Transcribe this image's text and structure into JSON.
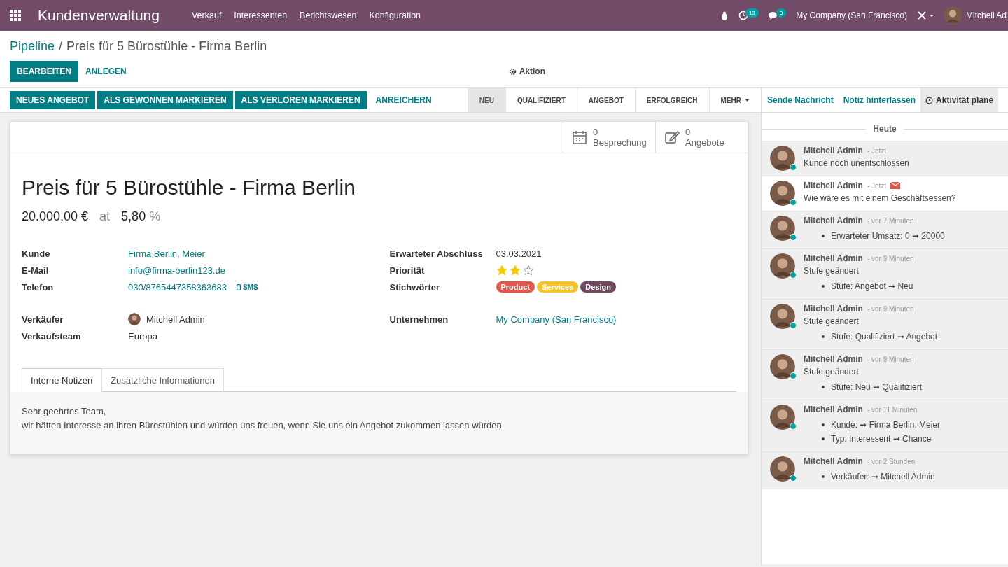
{
  "navbar": {
    "app_title": "Kundenverwaltung",
    "menu": [
      "Verkauf",
      "Interessenten",
      "Berichtswesen",
      "Konfiguration"
    ],
    "activity_count": "13",
    "message_count": "8",
    "company": "My Company (San Francisco)",
    "user": "Mitchell Ad"
  },
  "breadcrumb": {
    "parent": "Pipeline",
    "separator": "/",
    "current": "Preis für 5 Bürostühle - Firma Berlin"
  },
  "control_buttons": [
    {
      "label": "BEARBEITEN",
      "kind": "primary"
    },
    {
      "label": "ANLEGEN",
      "kind": "link"
    }
  ],
  "action_menu": "Aktion",
  "header_buttons": [
    {
      "label": "NEUES ANGEBOT",
      "kind": "primary"
    },
    {
      "label": "ALS GEWONNEN MARKIEREN",
      "kind": "primary"
    },
    {
      "label": "ALS VERLOREN MARKIEREN",
      "kind": "primary"
    },
    {
      "label": "ANREICHERN",
      "kind": "link"
    }
  ],
  "stages": [
    {
      "label": "NEU",
      "selected": true
    },
    {
      "label": "QUALIFIZIERT",
      "selected": false
    },
    {
      "label": "ANGEBOT",
      "selected": false
    },
    {
      "label": "ERFOLGREICH",
      "selected": false
    }
  ],
  "stages_more": "MEHR",
  "smart_buttons": [
    {
      "count": "0",
      "label": "Besprechung",
      "kind": "calendar"
    },
    {
      "count": "0",
      "label": "Angebote",
      "kind": "edit"
    }
  ],
  "record": {
    "title": "Preis für 5 Bürostühle - Firma Berlin",
    "revenue": "20.000,00 €",
    "at": "at",
    "probability": "5,80",
    "percent": "%"
  },
  "left_fields": [
    {
      "label": "Kunde",
      "value": "Firma Berlin, Meier",
      "kind": "link"
    },
    {
      "label": "E-Mail",
      "value": "info@firma-berlin123.de",
      "kind": "link"
    },
    {
      "label": "Telefon",
      "value": "030/8765447358363683",
      "kind": "phone",
      "extra": "SMS"
    },
    {
      "kind": "spacer"
    },
    {
      "label": "Verkäufer",
      "value": "Mitchell Admin",
      "kind": "user"
    },
    {
      "label": "Verkaufsteam",
      "value": "Europa",
      "kind": "text"
    }
  ],
  "right_fields": [
    {
      "label": "Erwarteter Abschluss",
      "value": "03.03.2021",
      "kind": "text"
    },
    {
      "label": "Priorität",
      "kind": "stars",
      "stars": 2
    },
    {
      "label": "Stichwörter",
      "kind": "tags",
      "tags": [
        {
          "name": "Product",
          "color": "#e2574c"
        },
        {
          "name": "Services",
          "color": "#f4c430"
        },
        {
          "name": "Design",
          "color": "#6d4a5f"
        }
      ]
    },
    {
      "kind": "spacer"
    },
    {
      "label": "Unternehmen",
      "value": "My Company (San Francisco)",
      "kind": "link"
    }
  ],
  "notebook": {
    "tabs": [
      {
        "label": "Interne Notizen",
        "selected": true
      },
      {
        "label": "Zusätzliche Informationen",
        "selected": false
      }
    ],
    "lines": [
      "Sehr geehrtes Team,",
      "wir hätten Interesse an ihren Bürostühlen und würden uns freuen, wenn Sie uns ein Angebot zukommen lassen würden."
    ]
  },
  "chatter": {
    "tabs": [
      {
        "label": "Sende Nachricht",
        "selected": false
      },
      {
        "label": "Notiz hinterlassen",
        "selected": false
      },
      {
        "label": "Aktivität plane",
        "selected": true
      }
    ],
    "date_separator": "Heute",
    "messages": [
      {
        "author": "Mitchell Admin",
        "time": "- Jetzt",
        "body": "Kunde noch unentschlossen",
        "kind": "note"
      },
      {
        "author": "Mitchell Admin",
        "time": "- Jetzt",
        "body": "Wie wäre es mit einem Geschäftsessen?",
        "kind": "email"
      },
      {
        "author": "Mitchell Admin",
        "time": "- vor 7 Minuten",
        "kind": "note",
        "changes": [
          "Erwarteter Umsatz: 0 ➞ 20000"
        ]
      },
      {
        "author": "Mitchell Admin",
        "time": "- vor 9 Minuten",
        "body": "Stufe geändert",
        "kind": "note",
        "changes": [
          "Stufe: Angebot ➞ Neu"
        ]
      },
      {
        "author": "Mitchell Admin",
        "time": "- vor 9 Minuten",
        "body": "Stufe geändert",
        "kind": "note",
        "changes": [
          "Stufe: Qualifiziert ➞ Angebot"
        ]
      },
      {
        "author": "Mitchell Admin",
        "time": "- vor 9 Minuten",
        "body": "Stufe geändert",
        "kind": "note",
        "changes": [
          "Stufe: Neu ➞ Qualifiziert"
        ]
      },
      {
        "author": "Mitchell Admin",
        "time": "- vor 11 Minuten",
        "kind": "note",
        "changes": [
          "Kunde: ➞ Firma Berlin, Meier",
          "Typ: Interessent ➞ Chance"
        ]
      },
      {
        "author": "Mitchell Admin",
        "time": "- vor 2 Stunden",
        "kind": "note",
        "changes": [
          "Verkäufer: ➞ Mitchell Admin"
        ]
      }
    ]
  }
}
